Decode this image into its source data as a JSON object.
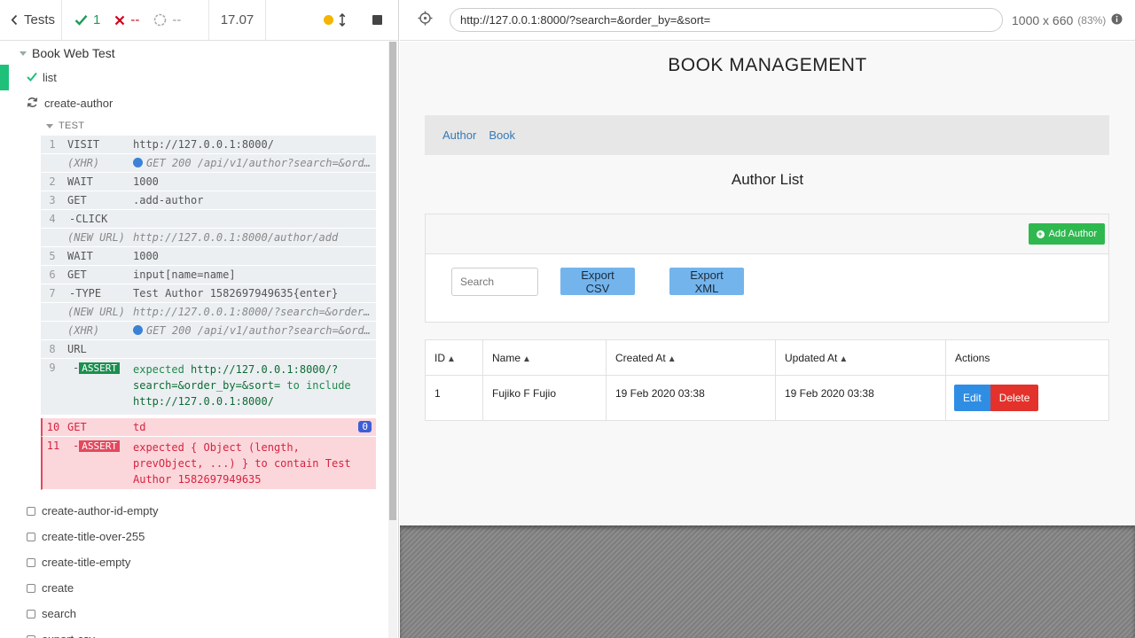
{
  "reporter": {
    "back_label": "Tests",
    "passed_count": "1",
    "failed_count": "--",
    "pending_count": "--",
    "duration": "17.07",
    "suite_title": "Book Web Test",
    "tests_before": [
      {
        "label": "list",
        "state": "passed"
      },
      {
        "label": "create-author",
        "state": "running"
      }
    ],
    "hook_title": "TEST",
    "commands": [
      {
        "num": "1",
        "name": "VISIT",
        "msg": "http://127.0.0.1:8000/"
      },
      {
        "num": "",
        "name": "(XHR)",
        "msg": "GET 200 /api/v1/author?search=&order_by=&sort=",
        "event": true,
        "xhr": true
      },
      {
        "num": "2",
        "name": "WAIT",
        "msg": "1000"
      },
      {
        "num": "3",
        "name": "GET",
        "msg": ".add-author"
      },
      {
        "num": "4",
        "name": "-CLICK",
        "msg": "",
        "child": true
      },
      {
        "num": "",
        "name": "(NEW URL)",
        "msg": "http://127.0.0.1:8000/author/add",
        "event": true
      },
      {
        "num": "5",
        "name": "WAIT",
        "msg": "1000"
      },
      {
        "num": "6",
        "name": "GET",
        "msg": "input[name=name]"
      },
      {
        "num": "7",
        "name": "-TYPE",
        "msg": "Test Author 1582697949635{enter}",
        "child": true
      },
      {
        "num": "",
        "name": "(NEW URL)",
        "msg": "http://127.0.0.1:8000/?search=&order_by=&sort=",
        "event": true
      },
      {
        "num": "",
        "name": "(XHR)",
        "msg": "GET 200 /api/v1/author?search=&order_by=&sort=",
        "event": true,
        "xhr": true
      },
      {
        "num": "8",
        "name": "URL",
        "msg": ""
      }
    ],
    "assert_pass": {
      "num": "9",
      "prefix": "-",
      "badge": "ASSERT",
      "expected": "expected",
      "url1": "http://127.0.0.1:8000/?search=&order_by=&sort=",
      "to_include": "to include",
      "url2": "http://127.0.0.1:8000/"
    },
    "fail_get": {
      "num": "10",
      "name": "GET",
      "msg": "td",
      "count": "0"
    },
    "fail_assert": {
      "num": "11",
      "prefix": "-",
      "badge": "ASSERT",
      "msg": "expected { Object (length, prevObject, ...) } to contain Test Author 1582697949635"
    },
    "tests_after": [
      "create-author-id-empty",
      "create-title-over-255",
      "create-title-empty",
      "create",
      "search",
      "export-csv"
    ]
  },
  "aut": {
    "url": "http://127.0.0.1:8000/?search=&order_by=&sort=",
    "viewport": "1000 x 660",
    "scale": "(83%)"
  },
  "app": {
    "title": "BOOK MANAGEMENT",
    "nav": [
      "Author",
      "Book"
    ],
    "section_title": "Author List",
    "add_author_label": "Add Author",
    "search_placeholder": "Search",
    "export_csv": "Export CSV",
    "export_xml": "Export XML",
    "table": {
      "headers": [
        "ID",
        "Name",
        "Created At",
        "Updated At",
        "Actions"
      ],
      "rows": [
        {
          "id": "1",
          "name": "Fujiko F Fujio",
          "created": "19 Feb 2020 03:38",
          "updated": "19 Feb 2020 03:38"
        }
      ],
      "edit_label": "Edit",
      "delete_label": "Delete"
    }
  },
  "colors": {
    "pass_green": "#1fc17a",
    "fail_red": "#e24a5e",
    "link_blue": "#337ab7",
    "add_green": "#2fb84f",
    "export_blue": "#74b4ec",
    "edit_blue": "#2f8de4",
    "delete_red": "#e3322b"
  }
}
